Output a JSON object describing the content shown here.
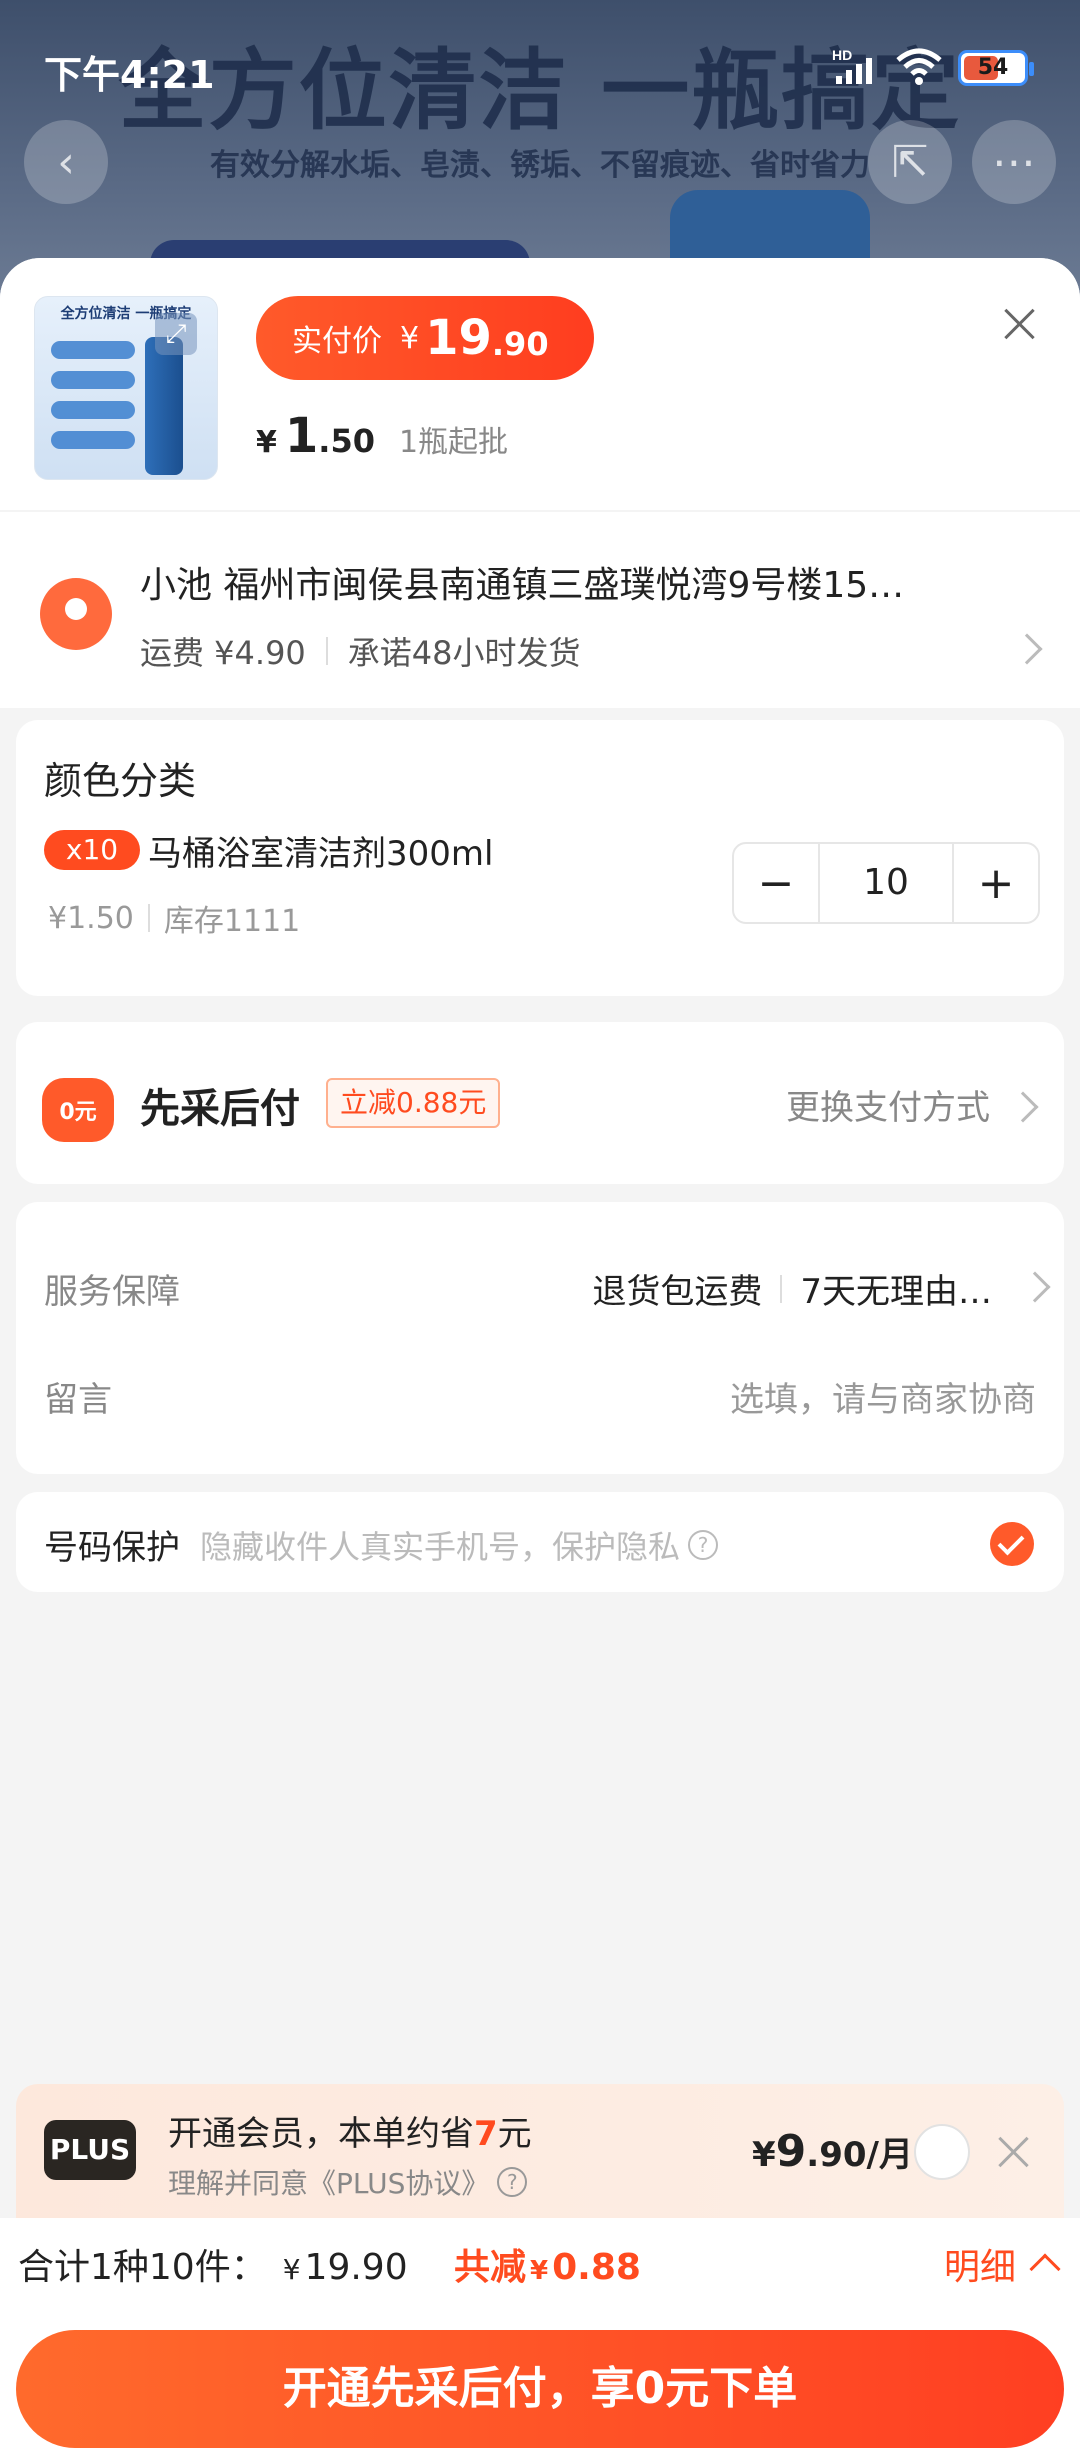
{
  "status": {
    "time": "下午4:21",
    "battery": "54",
    "network": "HD"
  },
  "background": {
    "headline": "全方位清洁 一瓶搞定",
    "subline": "有效分解水垢、皂渍、锈垢、不留痕迹、省时省力"
  },
  "product": {
    "thumb_title": "全方位清洁 一瓶搞定",
    "price_label": "实付价",
    "price_yen": "¥",
    "price_int": "19",
    "price_dec": ".90",
    "unit_yen": "¥",
    "unit_int": "1",
    "unit_dec": ".50",
    "min_order": "1瓶起批"
  },
  "address": {
    "line1": "小池 福州市闽侯县南通镇三盛璞悦湾9号楼15…",
    "shipping": "运费 ¥4.90",
    "promise": "承诺48小时发货"
  },
  "color_section": {
    "title": "颜色分类",
    "badge": "x10",
    "sku_name": "马桶浴室清洁剂300ml",
    "sku_price": "¥1.50",
    "stock": "库存1111",
    "quantity": "10",
    "minus": "−",
    "plus": "+"
  },
  "payment": {
    "icon_text": "0元",
    "title": "先采后付",
    "tag": "立减0.88元",
    "switch": "更换支付方式"
  },
  "service": {
    "label": "服务保障",
    "item1": "退货包运费",
    "item2": "7天无理由…",
    "message_label": "留言",
    "message_placeholder": "选填，请与商家协商"
  },
  "phone_protect": {
    "label": "号码保护",
    "hint": "隐藏收件人真实手机号，保护隐私",
    "checked": true
  },
  "plus": {
    "logo": "PLUS",
    "line1_a": "开通会员，本单约省",
    "line1_hi": "7",
    "line1_b": "元",
    "line2": "理解并同意《PLUS协议》",
    "price_yen": "¥",
    "price_int": "9",
    "price_rest": ".90/月"
  },
  "total": {
    "label": "合计1种10件：",
    "yen": "¥",
    "amount": "19.90",
    "save_label": "共减",
    "save_yen": "¥",
    "save_amount": "0.88",
    "detail": "明细"
  },
  "cta": {
    "label": "开通先采后付，享0元下单"
  },
  "colors": {
    "accent": "#ff4b1f",
    "cta_start": "#ff6a2c",
    "cta_end": "#ff3f22"
  }
}
